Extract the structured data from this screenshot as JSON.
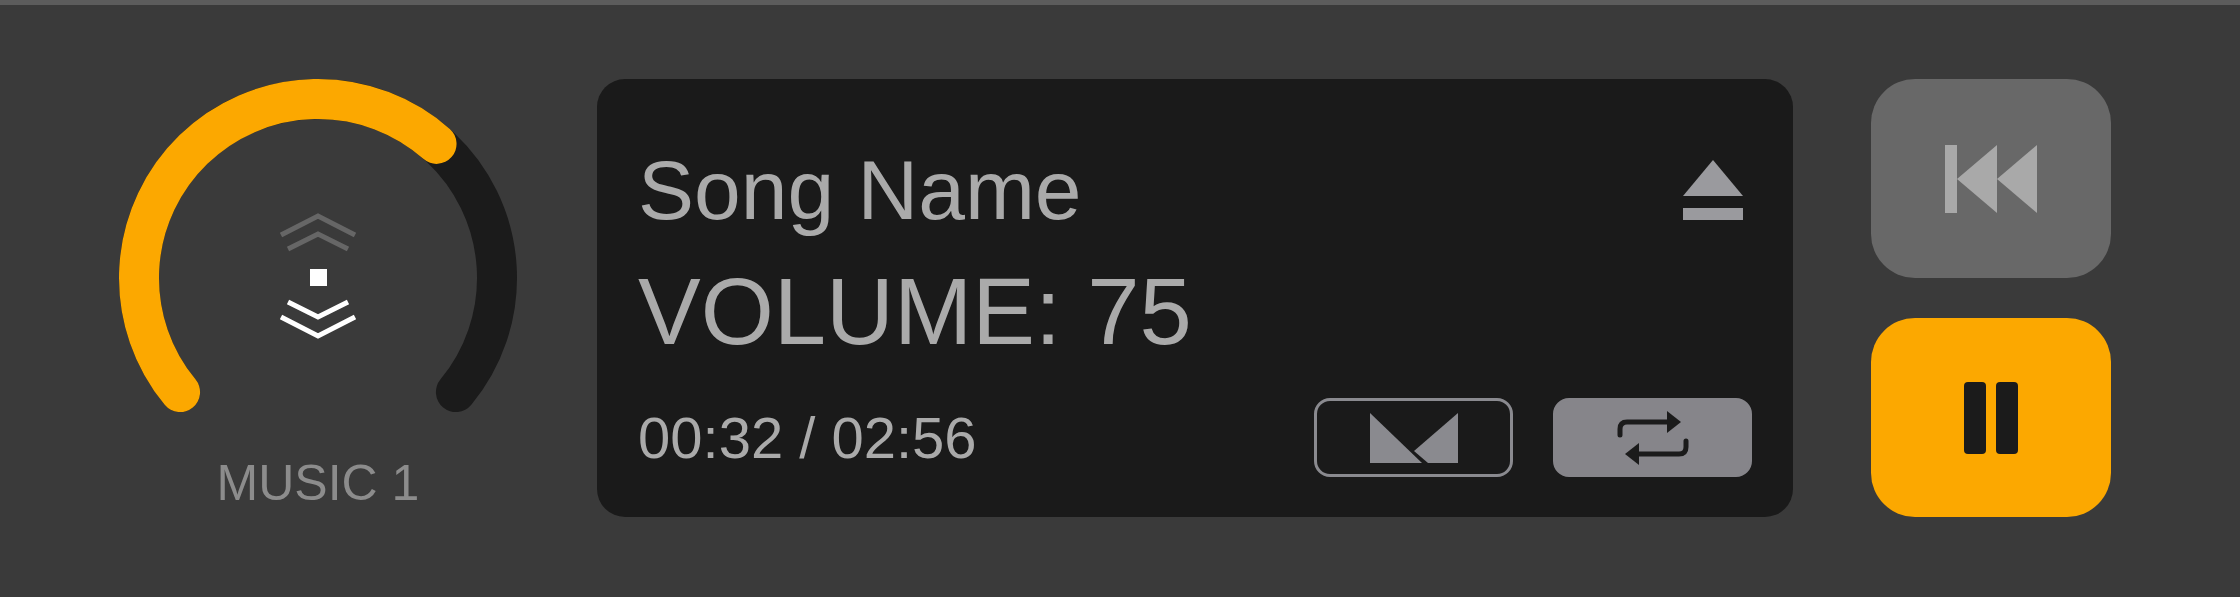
{
  "knob": {
    "label": "MUSIC 1"
  },
  "display": {
    "title": "Song Name",
    "volume": "VOLUME: 75",
    "time": "00:32 / 02:56"
  },
  "display_buttons": [
    {
      "kind": "mirror",
      "on": false
    },
    {
      "kind": "repeat",
      "on": true
    }
  ],
  "transport": [
    {
      "kind": "rewind"
    },
    {
      "kind": "pause"
    }
  ]
}
